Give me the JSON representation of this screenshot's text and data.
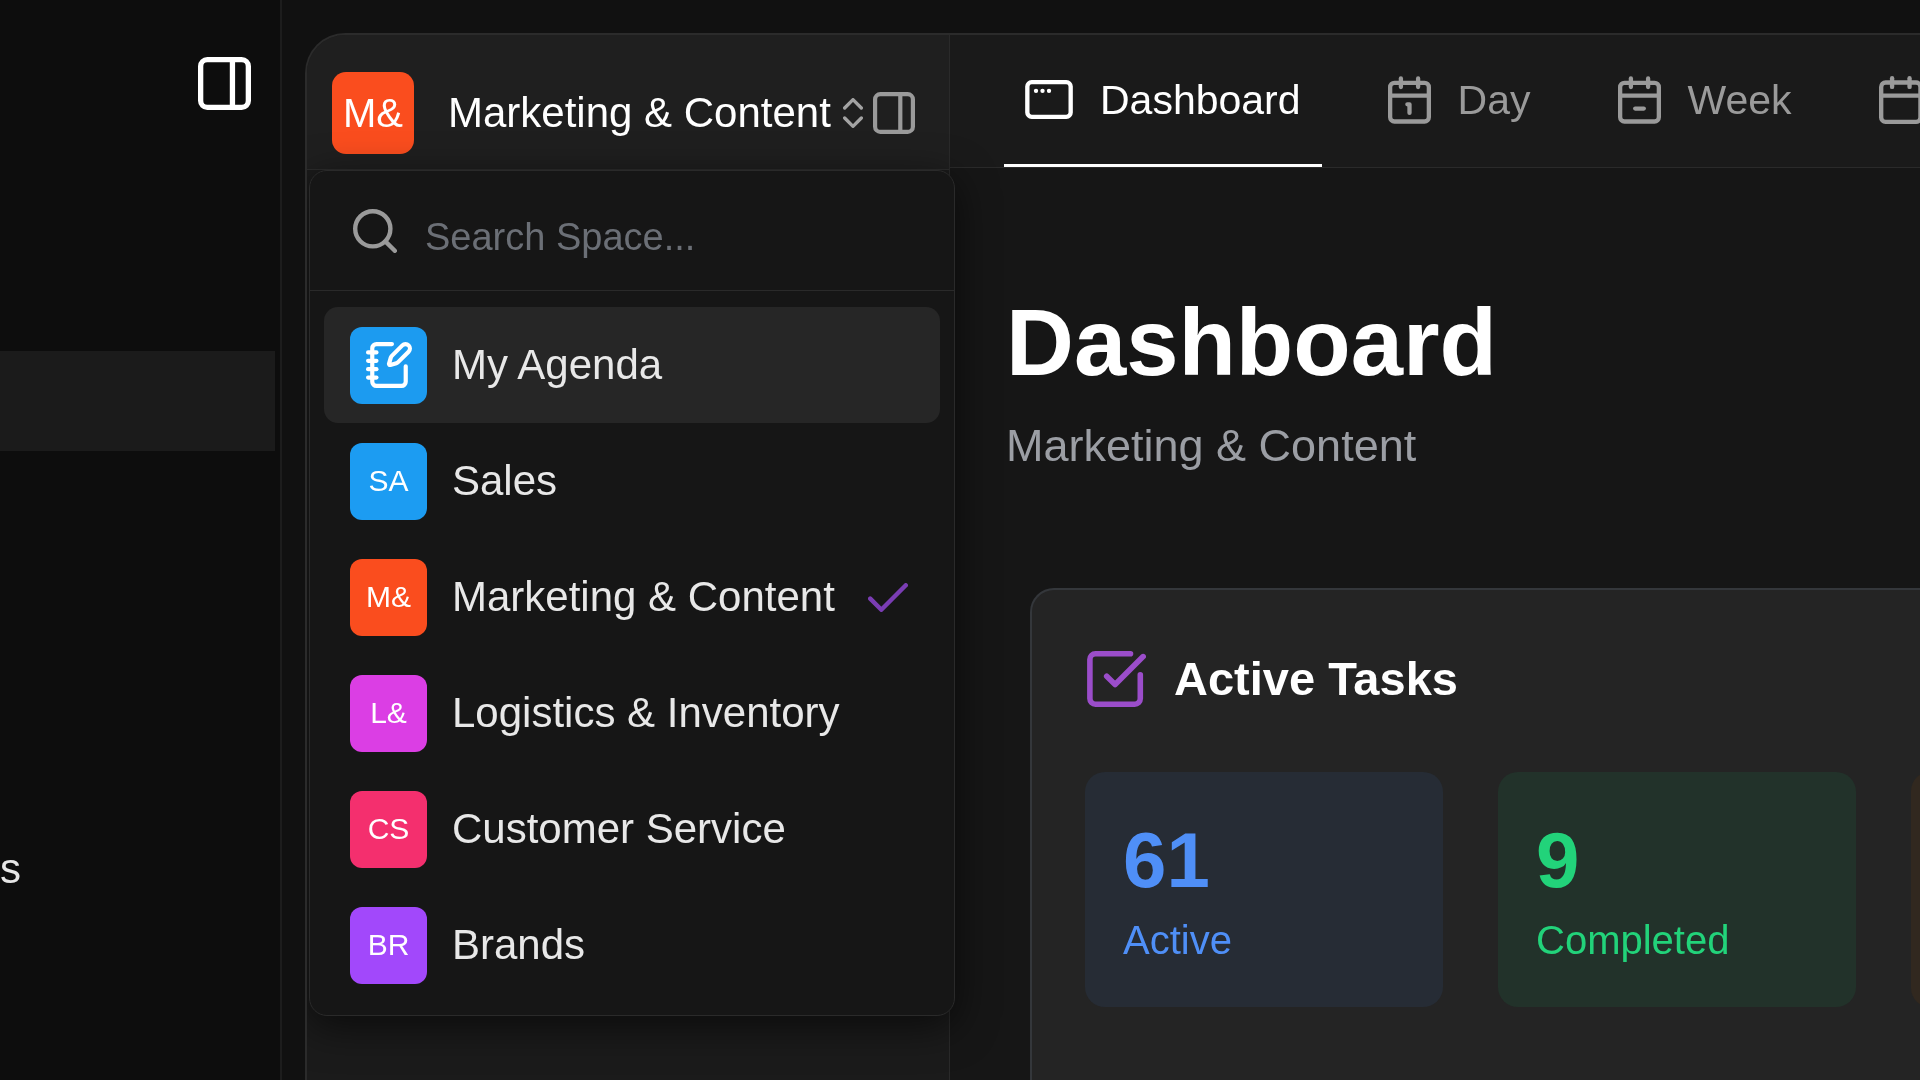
{
  "left_panel": {
    "items": [
      {
        "selected": true
      },
      {
        "label": "s",
        "selected": false
      }
    ]
  },
  "space_switcher": {
    "initials": "M&",
    "color": "#fa4d1e",
    "title": "Marketing & Content"
  },
  "space_menu": {
    "search": {
      "placeholder": "Search Space..."
    },
    "items": [
      {
        "kind": "agenda",
        "label": "My Agenda",
        "color": "#1c9bf0",
        "highlighted": true,
        "selected": false
      },
      {
        "kind": "initials",
        "initials": "SA",
        "label": "Sales",
        "color": "#1c9cf2",
        "highlighted": false,
        "selected": false
      },
      {
        "kind": "initials",
        "initials": "M&",
        "label": "Marketing & Content",
        "color": "#fa4d1e",
        "highlighted": false,
        "selected": true
      },
      {
        "kind": "initials",
        "initials": "L&",
        "label": "Logistics & Inventory",
        "color": "#db3ee4",
        "highlighted": false,
        "selected": false
      },
      {
        "kind": "initials",
        "initials": "CS",
        "label": "Customer Service",
        "color": "#f42f6e",
        "highlighted": false,
        "selected": false
      },
      {
        "kind": "initials",
        "initials": "BR",
        "label": "Brands",
        "color": "#a248fb",
        "highlighted": false,
        "selected": false
      }
    ]
  },
  "tabs": [
    {
      "kind": "dashboard",
      "label": "Dashboard",
      "selected": true
    },
    {
      "kind": "day",
      "label": "Day",
      "selected": false
    },
    {
      "kind": "week",
      "label": "Week",
      "selected": false
    },
    {
      "kind": "calendar",
      "selected": false
    }
  ],
  "page": {
    "title": "Dashboard",
    "subtitle": "Marketing & Content"
  },
  "active_tasks": {
    "title": "Active Tasks",
    "stats": [
      {
        "color": "#4f8ff7",
        "value": "61",
        "label": "Active"
      },
      {
        "color": "#22d37a",
        "value": "9",
        "label": "Completed"
      },
      {
        "color": "#31281f"
      }
    ]
  }
}
